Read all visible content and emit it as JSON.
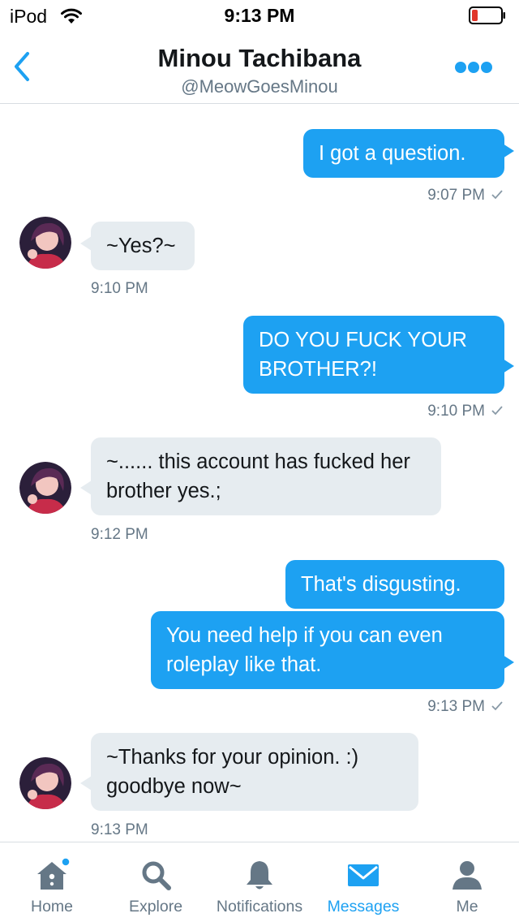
{
  "status_bar": {
    "carrier": "iPod",
    "time": "9:13 PM"
  },
  "header": {
    "name": "Minou Tachibana",
    "handle": "@MeowGoesMinou"
  },
  "messages": [
    {
      "direction": "out",
      "text": "I got a question.",
      "time": "9:07 PM"
    },
    {
      "direction": "in",
      "text": "~Yes?~",
      "time": "9:10 PM"
    },
    {
      "direction": "out",
      "text": "DO YOU FUCK YOUR BROTHER?!",
      "time": "9:10 PM"
    },
    {
      "direction": "in",
      "text": "~...... this account has fucked her brother yes.;",
      "time": "9:12 PM"
    },
    {
      "direction": "out",
      "text": "That's disgusting."
    },
    {
      "direction": "out",
      "text": "You need help if you can even roleplay like that.",
      "time": "9:13 PM"
    },
    {
      "direction": "in",
      "text": "~Thanks for your opinion. :) goodbye now~",
      "time": "9:13 PM"
    }
  ],
  "tabs": [
    {
      "label": "Home",
      "icon": "home-icon",
      "badge": true
    },
    {
      "label": "Explore",
      "icon": "search-icon"
    },
    {
      "label": "Notifications",
      "icon": "bell-icon"
    },
    {
      "label": "Messages",
      "icon": "envelope-icon",
      "active": true
    },
    {
      "label": "Me",
      "icon": "person-icon"
    }
  ],
  "colors": {
    "accent": "#1da1f2",
    "incoming_bubble": "#e6ecf0",
    "secondary_text": "#657786",
    "battery_low": "#e0362b"
  }
}
